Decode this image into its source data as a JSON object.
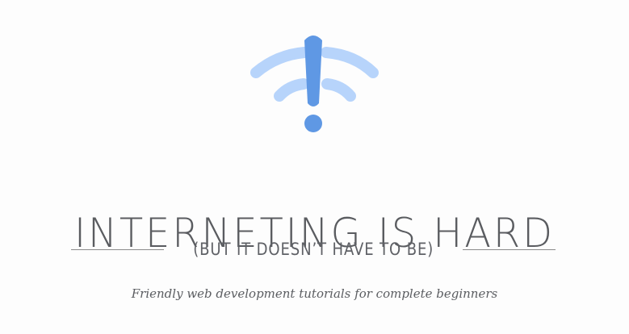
{
  "brand": {
    "logo_icon": "wifi-exclamation-icon",
    "colors": {
      "wave": "#b7d4fb",
      "exclamation": "#5f98e4",
      "text": "#5a5c60",
      "rule": "#8a8a8a"
    }
  },
  "hero": {
    "title": "INTERNETING IS HARD",
    "subtitle": "(BUT IT DOESN’T HAVE TO BE)",
    "tagline": "Friendly web development tutorials for complete beginners"
  }
}
